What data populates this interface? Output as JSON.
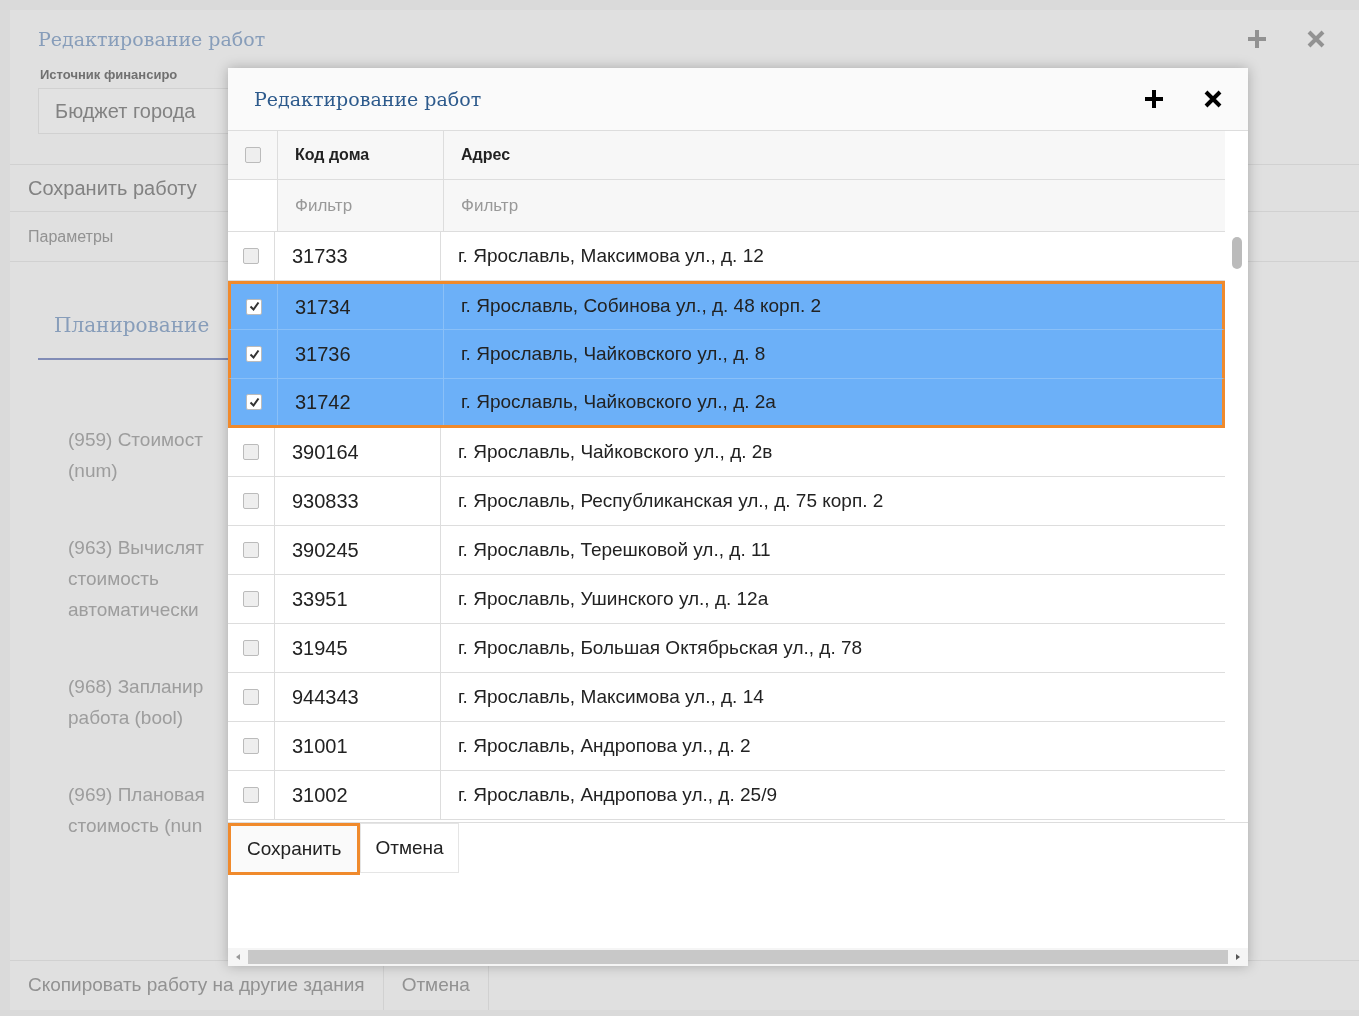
{
  "background_window": {
    "title": "Редактирование работ",
    "cut_label": "Источник финансиро",
    "funding_field": {
      "value": "Бюджет города"
    },
    "save_work_button": "Сохранить работу",
    "section_title": "Параметры",
    "tabs": [
      {
        "label": "Планирование",
        "selected": true
      }
    ],
    "parameters": [
      {
        "text": "(959) Стоимост\n(num)"
      },
      {
        "text": "(963) Вычислят\nстоимость\nавтоматически"
      },
      {
        "text": "(968) Запланир\nработа (bool)"
      },
      {
        "text": "(969) Плановая\nстоимость (nun"
      }
    ],
    "footer_buttons": [
      "Скопировать работу на другие здания",
      "Отмена"
    ]
  },
  "dialog": {
    "title": "Редактирование работ",
    "table": {
      "select_all_checked": false,
      "columns": [
        {
          "title": "Код дома",
          "filter_placeholder": "Фильтр"
        },
        {
          "title": "Адрес",
          "filter_placeholder": "Фильтр"
        }
      ],
      "rows": [
        {
          "code": "31733",
          "address": "г. Ярославль, Максимова ул., д. 12",
          "checked": false
        },
        {
          "code": "31734",
          "address": "г. Ярославль, Собинова ул., д. 48 корп. 2",
          "checked": true
        },
        {
          "code": "31736",
          "address": "г. Ярославль, Чайковского ул., д. 8",
          "checked": true
        },
        {
          "code": "31742",
          "address": "г. Ярославль, Чайковского ул., д. 2а",
          "checked": true
        },
        {
          "code": "390164",
          "address": "г. Ярославль, Чайковского ул., д. 2в",
          "checked": false
        },
        {
          "code": "930833",
          "address": "г. Ярославль, Республиканская ул., д. 75 корп. 2",
          "checked": false
        },
        {
          "code": "390245",
          "address": "г. Ярославль, Терешковой ул., д. 11",
          "checked": false
        },
        {
          "code": "33951",
          "address": "г. Ярославль, Ушинского ул., д. 12а",
          "checked": false
        },
        {
          "code": "31945",
          "address": "г. Ярославль, Большая Октябрьская ул., д. 78",
          "checked": false
        },
        {
          "code": "944343",
          "address": "г. Ярославль, Максимова ул., д. 14",
          "checked": false
        },
        {
          "code": "31001",
          "address": "г. Ярославль, Андропова ул., д. 2",
          "checked": false
        },
        {
          "code": "31002",
          "address": "г. Ярославль, Андропова ул., д. 25/9",
          "checked": false
        }
      ]
    },
    "buttons": [
      {
        "label": "Сохранить",
        "highlighted": true
      },
      {
        "label": "Отмена",
        "highlighted": false
      }
    ]
  }
}
